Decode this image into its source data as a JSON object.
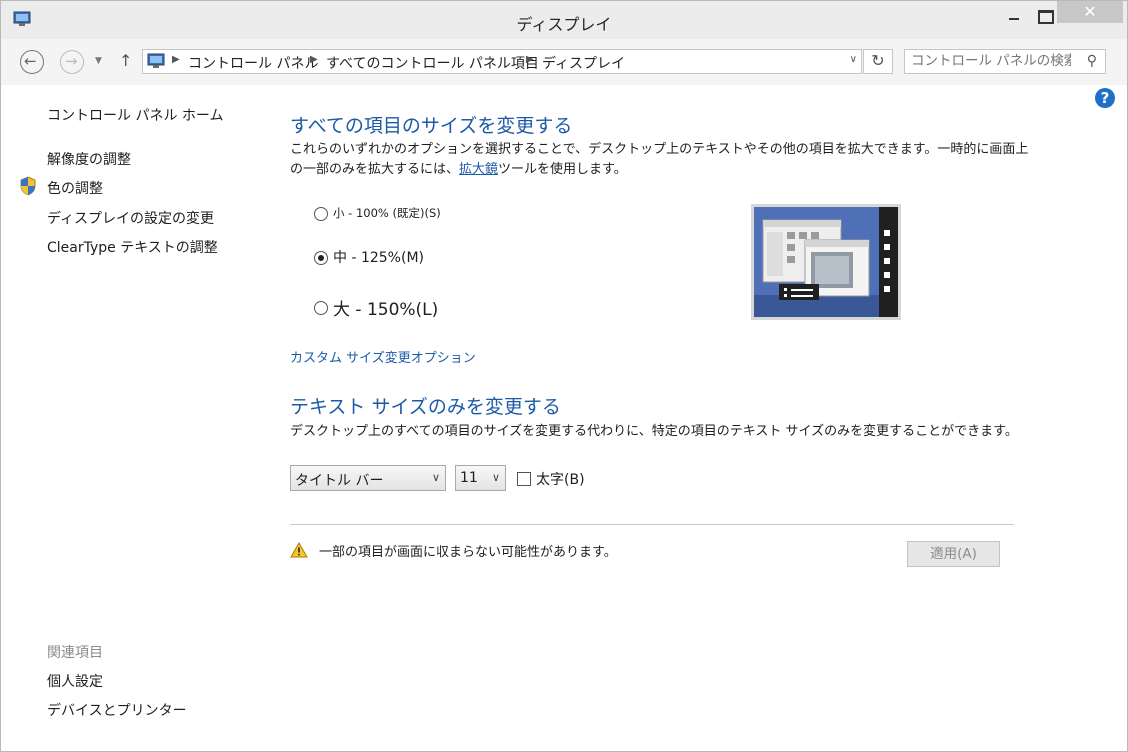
{
  "window": {
    "title": "ディスプレイ",
    "close_glyph": "✕"
  },
  "nav": {
    "back_glyph": "←",
    "forward_glyph": "→",
    "history_glyph": "▼",
    "up_glyph": "↑",
    "breadcrumb": [
      "コントロール パネル",
      "すべてのコントロール パネル項目",
      "ディスプレイ"
    ],
    "separator_glyph": "▶",
    "address_dropdown_glyph": "∨",
    "refresh_glyph": "↻",
    "search_placeholder": "コントロール パネルの検索",
    "search_glyph": "⚲"
  },
  "sidebar": {
    "home": "コントロール パネル ホーム",
    "items": [
      "解像度の調整",
      "色の調整",
      "ディスプレイの設定の変更",
      "ClearType テキストの調整"
    ],
    "related_header": "関連項目",
    "related": [
      "個人設定",
      "デバイスとプリンター"
    ]
  },
  "help_glyph": "?",
  "main": {
    "section1_title": "すべての項目のサイズを変更する",
    "section1_desc_pre": "これらのいずれかのオプションを選択することで、デスクトップ上のテキストやその他の項目を拡大できます。一時的に画面上の一部のみを拡大するには、",
    "section1_link": "拡大鏡",
    "section1_desc_post": "ツールを使用します。",
    "options": [
      {
        "label": "小 - 100% (既定)(S)",
        "selected": false
      },
      {
        "label": "中 - 125%(M)",
        "selected": true
      },
      {
        "label": "大 - 150%(L)",
        "selected": false
      }
    ],
    "custom_link": "カスタム サイズ変更オプション",
    "section2_title": "テキスト サイズのみを変更する",
    "section2_desc": "デスクトップ上のすべての項目のサイズを変更する代わりに、特定の項目のテキスト サイズのみを変更することができます。",
    "element_select": "タイトル バー",
    "size_select": "11",
    "dropdown_glyph": "∨",
    "bold_label": "太字(B)",
    "bold_checked": false,
    "warning_text": "一部の項目が画面に収まらない可能性があります。",
    "apply_label": "適用(A)"
  }
}
